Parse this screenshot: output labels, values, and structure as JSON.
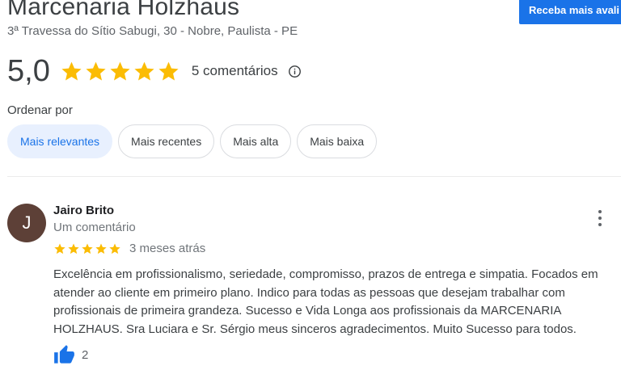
{
  "business": {
    "name": "Marcenaria Holzhaus",
    "address": "3ª Travessa do Sítio Sabugi, 30 - Nobre, Paulista - PE",
    "cta_label": "Receba mais avali"
  },
  "summary": {
    "rating": "5,0",
    "stars": 5,
    "review_count": "5 comentários",
    "star_color": "#fbbc04",
    "info_icon": "info-icon"
  },
  "sort": {
    "label": "Ordenar por",
    "options": [
      "Mais relevantes",
      "Mais recentes",
      "Mais alta",
      "Mais baixa"
    ],
    "selected": "Mais relevantes"
  },
  "review": {
    "avatar_letter": "J",
    "avatar_color": "#5d4037",
    "author": "Jairo Brito",
    "meta": "Um comentário",
    "stars": 5,
    "date": "3 meses atrás",
    "text": "Excelência em profissionalismo, seriedade, compromisso, prazos de entrega e simpatia. Focados em atender ao cliente em primeiro plano. Indico para todas as pessoas que desejam trabalhar com profissionais de primeira grandeza. Sucesso e Vida Longa aos profissionais da MARCENARIA HOLZHAUS. Sra Luciara e Sr. Sérgio meus sinceros agradecimentos. Muito Sucesso para todos.",
    "likes": "2",
    "like_icon": "thumbs-up-icon",
    "menu_icon": "more-vert-icon"
  },
  "colors": {
    "accent": "#1a73e8",
    "chip_selected_bg": "#e8f0fe"
  }
}
